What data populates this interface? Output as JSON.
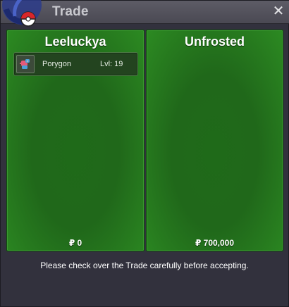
{
  "window": {
    "title": "Trade",
    "close_icon": "close-icon"
  },
  "panels": [
    {
      "name": "Leeluckya",
      "money": "₽ 0",
      "items": [
        {
          "name": "Porygon",
          "level": "Lvl: 19",
          "icon": "pokemon-icon"
        }
      ]
    },
    {
      "name": "Unfrosted",
      "money": "₽ 700,000",
      "items": []
    }
  ],
  "footer": {
    "message": "Please check over the Trade carefully before accepting."
  },
  "colors": {
    "panel_green": "#20681a",
    "window_bg": "#32313d",
    "title_text": "#c9c9cf"
  }
}
